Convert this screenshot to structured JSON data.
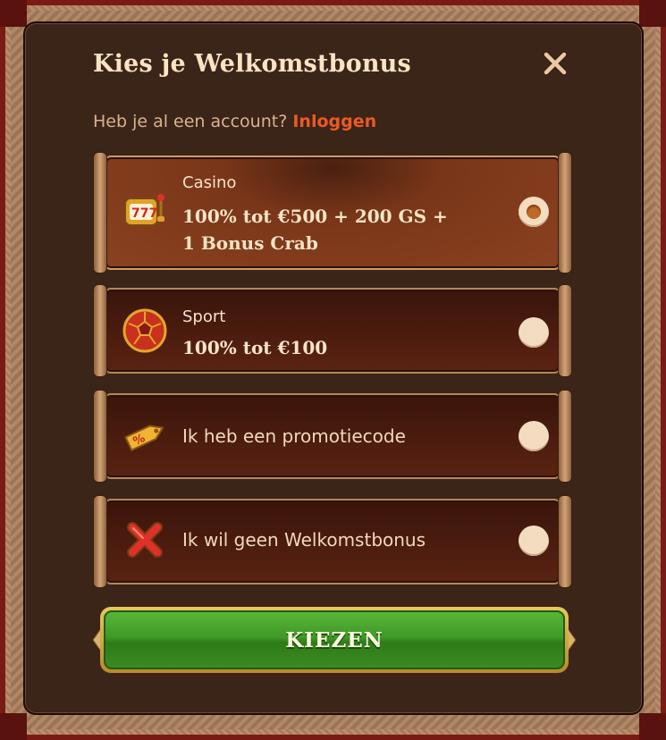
{
  "modal": {
    "title": "Kies je Welkomstbonus",
    "close_icon": "close-icon",
    "account_prompt": "Heb je al een account?",
    "login_link": "Inloggen"
  },
  "options": [
    {
      "id": "casino",
      "icon": "slot-machine-icon",
      "small": "Casino",
      "big_line1": "100% tot €500 + 200 GS +",
      "big_line2": "1 Bonus Crab",
      "selected": true
    },
    {
      "id": "sport",
      "icon": "football-icon",
      "small": "Sport",
      "big_line1": "100% tot €100",
      "selected": false
    },
    {
      "id": "promo",
      "icon": "promo-tag-icon",
      "text": "Ik heb een promotiecode",
      "selected": false
    },
    {
      "id": "none",
      "icon": "no-bonus-x-icon",
      "text": "Ik wil geen Welkomstbonus",
      "selected": false
    }
  ],
  "submit": {
    "label": "KIEZEN"
  },
  "colors": {
    "accent": "#ec5a24",
    "title": "#fbe3c4",
    "button_green": "#3f9a26",
    "modal_bg": "#3b2418"
  }
}
